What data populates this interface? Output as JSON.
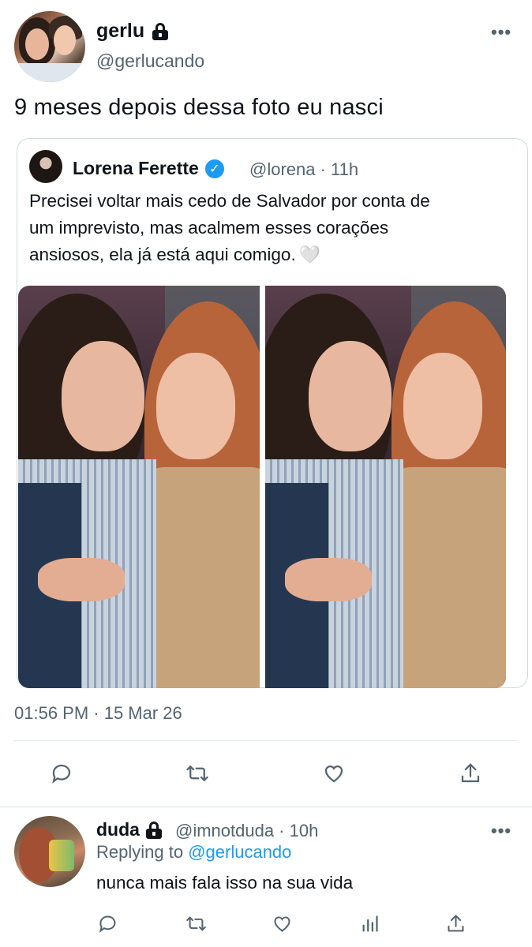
{
  "main_tweet": {
    "display_name": "gerlu",
    "handle": "@gerlucando",
    "text": "9 meses depois dessa foto eu nasci",
    "timestamp": "01:56 PM · 15 Mar 26",
    "icons": [
      "lock-icon",
      "more-icon"
    ]
  },
  "quoted_tweet": {
    "display_name": "Lorena Ferette",
    "handle_time": "@lorena · 11h",
    "text_lines": [
      "Precisei voltar mais cedo de Salvador por conta de",
      "um imprevisto, mas acalmem esses corações",
      "ansiosos, ela já está aqui comigo."
    ],
    "emoji": "🤍",
    "icons": [
      "verified-icon"
    ]
  },
  "actions": {
    "main": [
      "reply-icon",
      "retweet-icon",
      "like-icon",
      "share-icon"
    ],
    "reply": [
      "reply-icon",
      "retweet-icon",
      "like-icon",
      "analytics-icon",
      "share-icon"
    ]
  },
  "reply_tweet": {
    "display_name": "duda",
    "handle_time": "@imnotduda · 10h",
    "replying_prefix": "Replying to",
    "replying_to": "@gerlucando",
    "text": "nunca mais fala isso na sua vida"
  },
  "colors": {
    "text": "#0f1419",
    "secondary": "#536471",
    "link": "#1d9bf0",
    "border": "#cfd9de"
  }
}
